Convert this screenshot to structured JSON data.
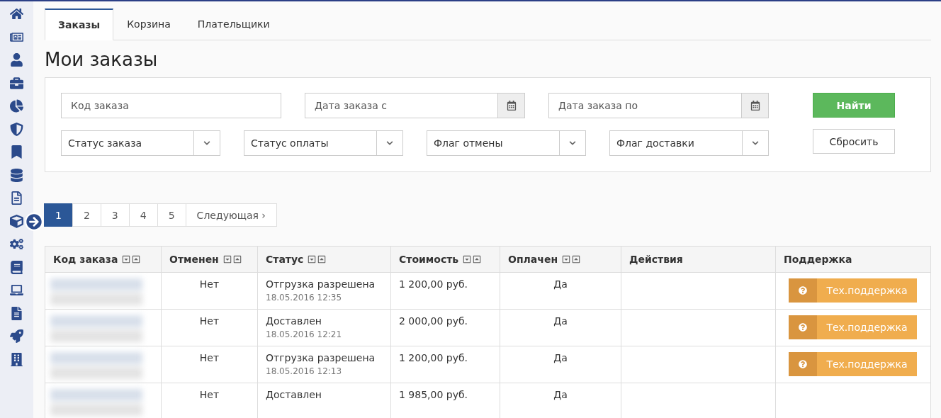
{
  "tabs": [
    {
      "label": "Заказы",
      "selected": true
    },
    {
      "label": "Корзина",
      "selected": false
    },
    {
      "label": "Плательщики",
      "selected": false
    }
  ],
  "title": "Мои заказы",
  "filters": {
    "row_1": [
      {
        "kind": "text",
        "placeholder": "Код заказа"
      },
      {
        "kind": "date",
        "placeholder": "Дата заказа с"
      },
      {
        "kind": "date",
        "placeholder": "Дата заказа по"
      }
    ],
    "row_2": [
      {
        "kind": "select",
        "placeholder": "Статус заказа"
      },
      {
        "kind": "select",
        "placeholder": "Статус оплаты"
      },
      {
        "kind": "select",
        "placeholder": "Флаг отмены"
      },
      {
        "kind": "select",
        "placeholder": "Флаг доставки"
      }
    ],
    "find_button": "Найти",
    "reset_button": "Сбросить"
  },
  "pagination": {
    "pages": [
      {
        "label": "1",
        "selected": true
      },
      {
        "label": "2",
        "selected": false
      },
      {
        "label": "3",
        "selected": false
      },
      {
        "label": "4",
        "selected": false
      },
      {
        "label": "5",
        "selected": false
      }
    ],
    "next": "Следующая ›"
  },
  "table": {
    "columns": [
      {
        "label": "Код заказа",
        "sortable": true
      },
      {
        "label": "Отменен",
        "sortable": true
      },
      {
        "label": "Статус",
        "sortable": true
      },
      {
        "label": "Стоимость",
        "sortable": true
      },
      {
        "label": "Оплачен",
        "sortable": true
      },
      {
        "label": "Действия",
        "sortable": false
      },
      {
        "label": "Поддержка",
        "sortable": false
      }
    ],
    "rows": [
      {
        "cancelled": "Нет",
        "status": "Отгрузка разрешена",
        "date": "18.05.2016 12:35",
        "cost": "1 200,00 руб.",
        "paid": "Да",
        "support": "Тех.поддержка"
      },
      {
        "cancelled": "Нет",
        "status": "Доставлен",
        "date": "18.05.2016 12:21",
        "cost": "2 000,00 руб.",
        "paid": "Да",
        "support": "Тех.поддержка"
      },
      {
        "cancelled": "Нет",
        "status": "Отгрузка разрешена",
        "date": "18.05.2016 12:13",
        "cost": "1 200,00 руб.",
        "paid": "Да",
        "support": "Тех.поддержка"
      },
      {
        "cancelled": "Нет",
        "status": "Доставлен",
        "cost": "1 985,00 руб.",
        "paid": "Да"
      }
    ]
  }
}
